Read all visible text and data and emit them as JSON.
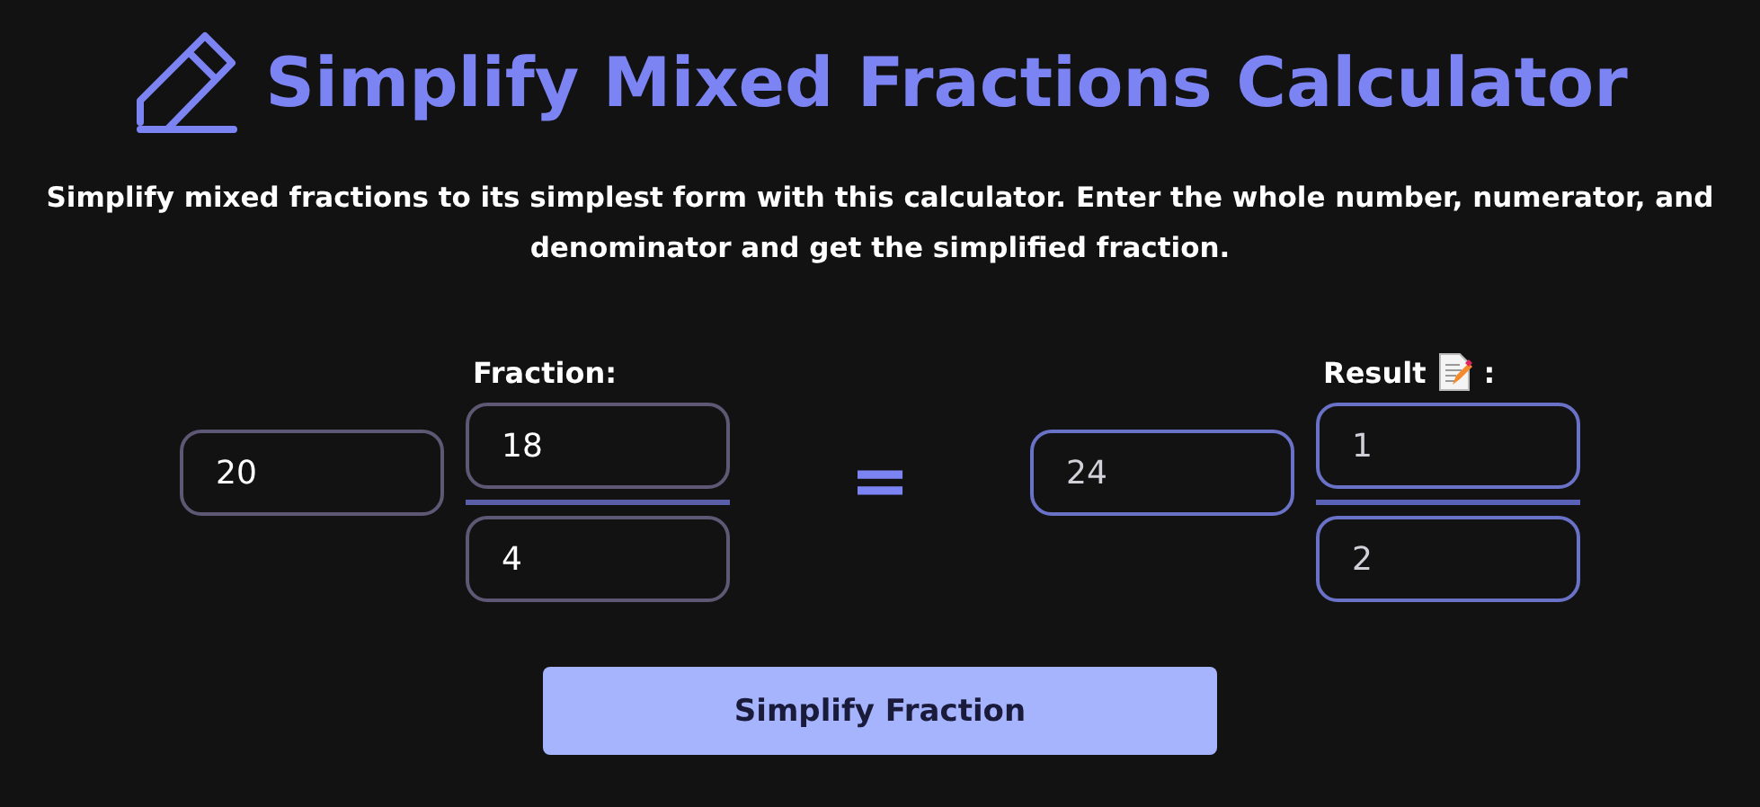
{
  "title": "Simplify Mixed Fractions Calculator",
  "description": "Simplify mixed fractions to its simplest form with this calculator. Enter the whole number, numerator, and denominator and get the simplified fraction.",
  "groups": [
    {
      "label": "Fraction:",
      "has_icon": false,
      "readonly": false,
      "whole": "20",
      "numerator": "18",
      "denominator": "4"
    },
    {
      "label": "Result",
      "label_suffix": ":",
      "has_icon": true,
      "readonly": true,
      "whole": "24",
      "numerator": "1",
      "denominator": "2"
    }
  ],
  "equals": "=",
  "button": "Simplify Fraction"
}
